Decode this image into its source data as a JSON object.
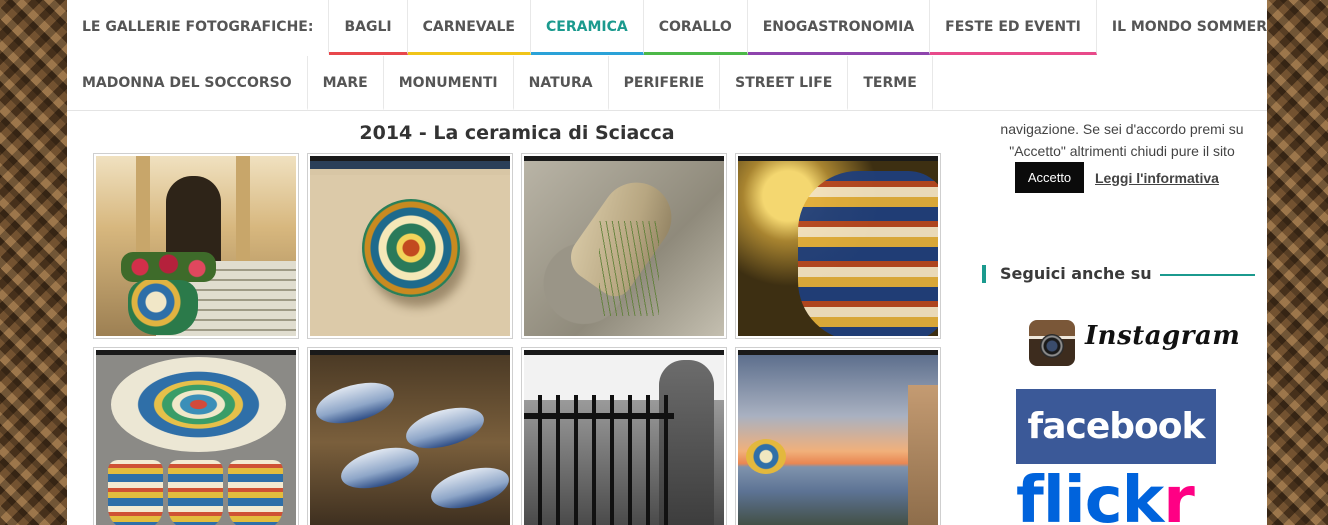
{
  "nav": {
    "lead_label": "LE GALLERIE FOTOGRAFICHE:",
    "row1": [
      {
        "label": "BAGLI",
        "color": "#e8474c",
        "active": false
      },
      {
        "label": "CARNEVALE",
        "color": "#f0c419",
        "active": false
      },
      {
        "label": "CERAMICA",
        "color": "#2aa2d8",
        "active": true
      },
      {
        "label": "CORALLO",
        "color": "#4cb848",
        "active": false
      },
      {
        "label": "ENOGASTRONOMIA",
        "color": "#8e44ad",
        "active": false
      },
      {
        "label": "FESTE ED EVENTI",
        "color": "#e84a8a",
        "active": false
      },
      {
        "label": "IL MONDO SOMMERSO",
        "color": "",
        "active": false
      }
    ],
    "row2": [
      {
        "label": "MADONNA DEL SOCCORSO"
      },
      {
        "label": "MARE"
      },
      {
        "label": "MONUMENTI"
      },
      {
        "label": "NATURA"
      },
      {
        "label": "PERIFERIE"
      },
      {
        "label": "STREET LIFE"
      },
      {
        "label": "TERME"
      }
    ],
    "active_color": "#1b9a8e"
  },
  "gallery": {
    "title": "2014 - La ceramica di Sciacca",
    "photos": [
      {
        "scene": "church-steps-vase"
      },
      {
        "scene": "ceramic-plate-sand"
      },
      {
        "scene": "amphora-rocks"
      },
      {
        "scene": "ceramic-vase-closeup"
      },
      {
        "scene": "mosaic-cups"
      },
      {
        "scene": "ceramic-fish"
      },
      {
        "scene": "iron-gate-tower"
      },
      {
        "scene": "sunset-coast"
      }
    ]
  },
  "sidebar": {
    "cookie_text_line1": "navigazione. Se sei d'accordo premi su",
    "cookie_text_line2": "\"Accetto\" altrimenti chiudi pure il sito",
    "accept_label": "Accetto",
    "info_label": "Leggi l'informativa",
    "follow_heading": "Seguici anche su",
    "instagram_label": "Instagram",
    "facebook_label": "facebook",
    "flickr_blue": "flick",
    "flickr_pink": "r",
    "accent_color": "#1b9a8e"
  }
}
